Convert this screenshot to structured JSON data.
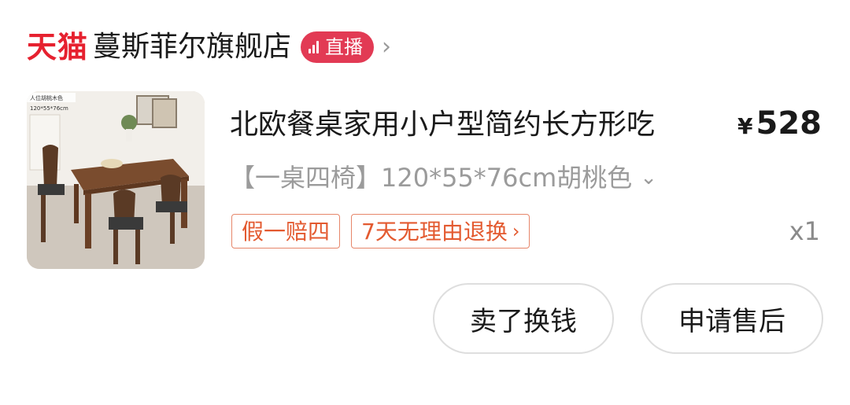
{
  "shop": {
    "platform_logo": "天猫",
    "name": "蔓斯菲尔旗舰店",
    "live_badge": "直播",
    "chevron": "›"
  },
  "item": {
    "thumbnail_icon": "dining-table-product-photo",
    "thumbnail_caption_1": "人位胡桃木色",
    "thumbnail_caption_2": "120*55*76cm",
    "title": "北欧餐桌家用小户型简约长方形吃",
    "price_symbol": "¥",
    "price": "528",
    "sku": "【一桌四椅】120*55*76cm胡桃色",
    "quantity": "x1",
    "tags": [
      {
        "label": "假一赔四"
      },
      {
        "label": "7天无理由退换"
      }
    ]
  },
  "actions": {
    "sell": "卖了换钱",
    "after_sales": "申请售后"
  },
  "colors": {
    "tmall_red": "#e6212f",
    "live_badge": "#e23a54",
    "tag_border": "#e6866a",
    "tag_text": "#e35a30"
  }
}
